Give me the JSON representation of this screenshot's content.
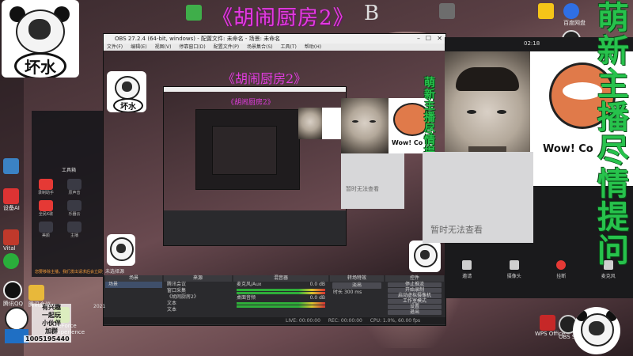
{
  "overlay": {
    "title": "《胡闹厨房2》",
    "title_extra": "B",
    "side_text_chars": [
      "萌",
      "新",
      "主",
      "播",
      "尽",
      "情",
      "提",
      "问"
    ],
    "side_text_color": "#27c24c",
    "title_color": "#e23ce0"
  },
  "panda_top": {
    "caption": "坏水"
  },
  "panda_bottom_left": {
    "lines": [
      "有兴趣",
      "一起玩",
      "小伙伴",
      "加群"
    ],
    "group_number": "1005195440"
  },
  "desktop": {
    "icons": [
      {
        "name": "ai-icon",
        "label": "AI"
      },
      {
        "name": "app-icon",
        "label": ""
      },
      {
        "name": "app-icon",
        "label": "设备AI"
      },
      {
        "name": "app-icon",
        "label": "Vital"
      },
      {
        "name": "wechat-icon",
        "label": ""
      },
      {
        "name": "qq-icon",
        "label": "腾讯QQ"
      },
      {
        "name": "folder-icon",
        "label": "腾讯会议"
      },
      {
        "name": "nvidia-icon",
        "label": "GeForce Experience"
      }
    ],
    "right_icons": [
      {
        "name": "app-icon",
        "label": ""
      },
      {
        "name": "baidu-icon",
        "label": "百度网盘"
      },
      {
        "name": "app-icon",
        "label": ""
      },
      {
        "name": "app-icon",
        "label": ""
      }
    ],
    "wps_label": "WPS Office",
    "obs_label": "OBS Studio",
    "date_label": "2021"
  },
  "obs": {
    "title": "OBS 27.2.4 (64-bit, windows) - 配置文件: 未命名 - 场景: 未命名",
    "menu": [
      "文件(F)",
      "编辑(E)",
      "视图(V)",
      "停靠窗口(D)",
      "配置文件(P)",
      "场景集合(S)",
      "工具(T)",
      "帮助(H)"
    ],
    "docks": {
      "scenes": "场景",
      "sources": "来源",
      "mixer": "混音器",
      "transitions": "转场特效",
      "controls": "控件"
    },
    "scene_items": [
      "场景"
    ],
    "source_items": [
      "腾讯会议",
      "窗口采集",
      "《胡闹厨房2》",
      "文本",
      "文本"
    ],
    "mixer_items": [
      {
        "label": "麦克风/Aux",
        "level": "0.0 dB"
      },
      {
        "label": "桌面音频",
        "level": "0.0 dB"
      }
    ],
    "transition": "淡出",
    "duration_label": "时长",
    "duration": "300 ms",
    "controls": [
      "停止推流",
      "开始录制",
      "启动虚拟摄像机",
      "工作室模式",
      "设置",
      "退出"
    ],
    "status": {
      "live": "LIVE: 00:00:00",
      "rec": "REC: 00:00:00",
      "cpu": "CPU: 1.0%, 60.00 fps"
    },
    "no_source_label": "未选择源"
  },
  "meeting": {
    "time": "02:18",
    "wow_text": "Wow! Co",
    "no_view_text": "暂时无法查看",
    "controls": [
      {
        "name": "invite-button",
        "label": "邀请"
      },
      {
        "name": "camera-button",
        "label": "摄像头"
      },
      {
        "name": "hangup-button",
        "label": "挂断"
      },
      {
        "name": "mic-button",
        "label": "麦克风"
      }
    ]
  },
  "leftpanel": {
    "heading": "工具箱",
    "tools": [
      {
        "label": "录制助手"
      },
      {
        "label": "原声音"
      },
      {
        "label": "全民K歌"
      },
      {
        "label": "乐器云"
      },
      {
        "label": "美颜"
      },
      {
        "label": "主播"
      }
    ],
    "footer": "您要移除主播，我们发出请求后会立即生效"
  }
}
